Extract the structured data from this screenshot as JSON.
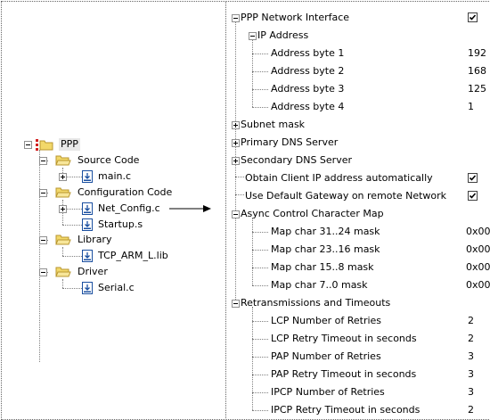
{
  "left_tree": {
    "root": "PPP",
    "groups": [
      {
        "label": "Source Code",
        "files": [
          "main.c"
        ]
      },
      {
        "label": "Configuration Code",
        "files": [
          "Net_Config.c",
          "Startup.s"
        ]
      },
      {
        "label": "Library",
        "files": [
          "TCP_ARM_L.lib"
        ]
      },
      {
        "label": "Driver",
        "files": [
          "Serial.c"
        ]
      }
    ]
  },
  "right_tree": {
    "ppp": {
      "label": "PPP Network Interface",
      "checked": true
    },
    "ip": {
      "label": "IP Address",
      "items": [
        {
          "label": "Address byte 1",
          "value": "192"
        },
        {
          "label": "Address byte 2",
          "value": "168"
        },
        {
          "label": "Address byte 3",
          "value": "125"
        },
        {
          "label": "Address byte 4",
          "value": "1"
        }
      ]
    },
    "subnet": "Subnet mask",
    "pdns": "Primary DNS Server",
    "sdns": "Secondary DNS Server",
    "obtain": {
      "label": "Obtain Client IP address automatically",
      "checked": true
    },
    "gateway": {
      "label": "Use Default Gateway on remote Network",
      "checked": true
    },
    "accm": {
      "label": "Async Control Character Map",
      "items": [
        {
          "label": "Map char 31..24 mask",
          "value": "0x00"
        },
        {
          "label": "Map char 23..16 mask",
          "value": "0x00"
        },
        {
          "label": "Map char 15..8 mask",
          "value": "0x00"
        },
        {
          "label": "Map char 7..0 mask",
          "value": "0x00"
        }
      ]
    },
    "retrans": {
      "label": "Retransmissions and Timeouts",
      "items": [
        {
          "label": "LCP Number of Retries",
          "value": "2"
        },
        {
          "label": "LCP Retry Timeout in seconds",
          "value": "2"
        },
        {
          "label": "PAP Number of Retries",
          "value": "3"
        },
        {
          "label": "PAP Retry Timeout in seconds",
          "value": "3"
        },
        {
          "label": "IPCP Number of Retries",
          "value": "3"
        },
        {
          "label": "IPCP Retry Timeout in seconds",
          "value": "2"
        }
      ]
    }
  },
  "colors": {
    "folder": "#f2d86a",
    "folder_edge": "#b8962e",
    "project_red": "#d22020",
    "file_blue": "#1a4fa0"
  }
}
